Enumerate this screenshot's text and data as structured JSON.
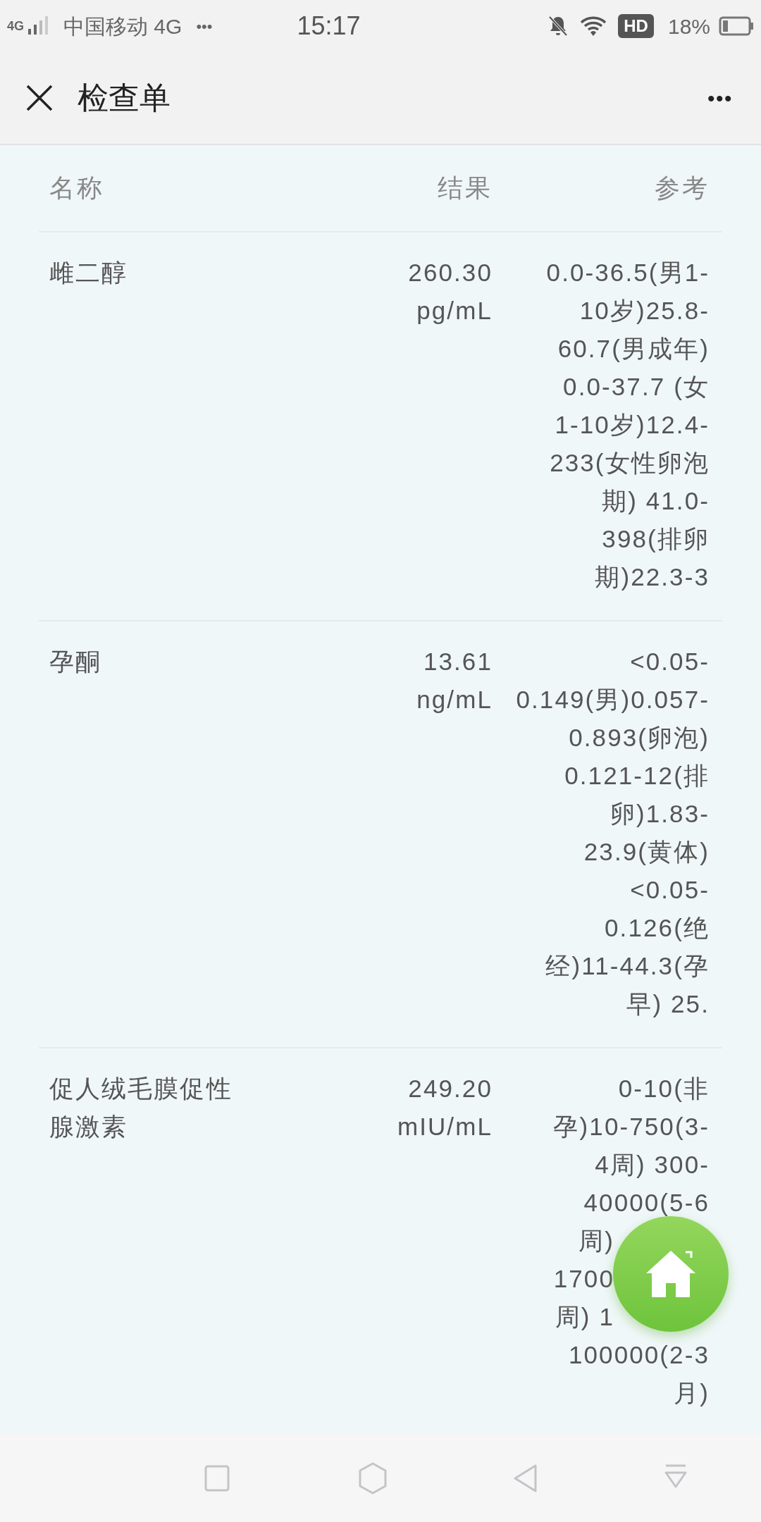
{
  "status_bar": {
    "network": "4G",
    "carrier": "中国移动 4G",
    "more": "•••",
    "time": "15:17",
    "hd": "HD",
    "battery": "18%"
  },
  "header": {
    "title": "检查单",
    "menu": "•••"
  },
  "table": {
    "columns": [
      "名称",
      "结果",
      "参考"
    ],
    "rows": [
      {
        "name": "雌二醇",
        "result": [
          "260.30",
          "pg/mL"
        ],
        "reference": [
          "0.0-36.5(男1-",
          "10岁)25.8-",
          "60.7(男成年)",
          "0.0-37.7 (女",
          "1-10岁)12.4-",
          "233(女性卵泡",
          "期) 41.0-",
          "398(排卵",
          "期)22.3-3"
        ]
      },
      {
        "name": "孕酮",
        "result": [
          "13.61",
          "ng/mL"
        ],
        "reference": [
          "<0.05-",
          "0.149(男)0.057-",
          "0.893(卵泡)",
          "0.121-12(排",
          "卵)1.83-",
          "23.9(黄体)",
          "<0.05-",
          "0.126(绝",
          "经)11-44.3(孕",
          "早) 25."
        ]
      },
      {
        "name": "促人绒毛膜促性腺激素",
        "result": [
          "249.20",
          "mIU/mL"
        ],
        "reference": [
          "0-10(非",
          "孕)10-750(3-",
          "4周) 300-",
          "40000(5-6",
          {
            "text": "周)",
            "covered": true
          },
          {
            "text": "1700",
            "covered": true
          },
          {
            "text": "周) 1",
            "covered": true
          },
          "100000(2-3",
          "月)"
        ]
      }
    ]
  }
}
